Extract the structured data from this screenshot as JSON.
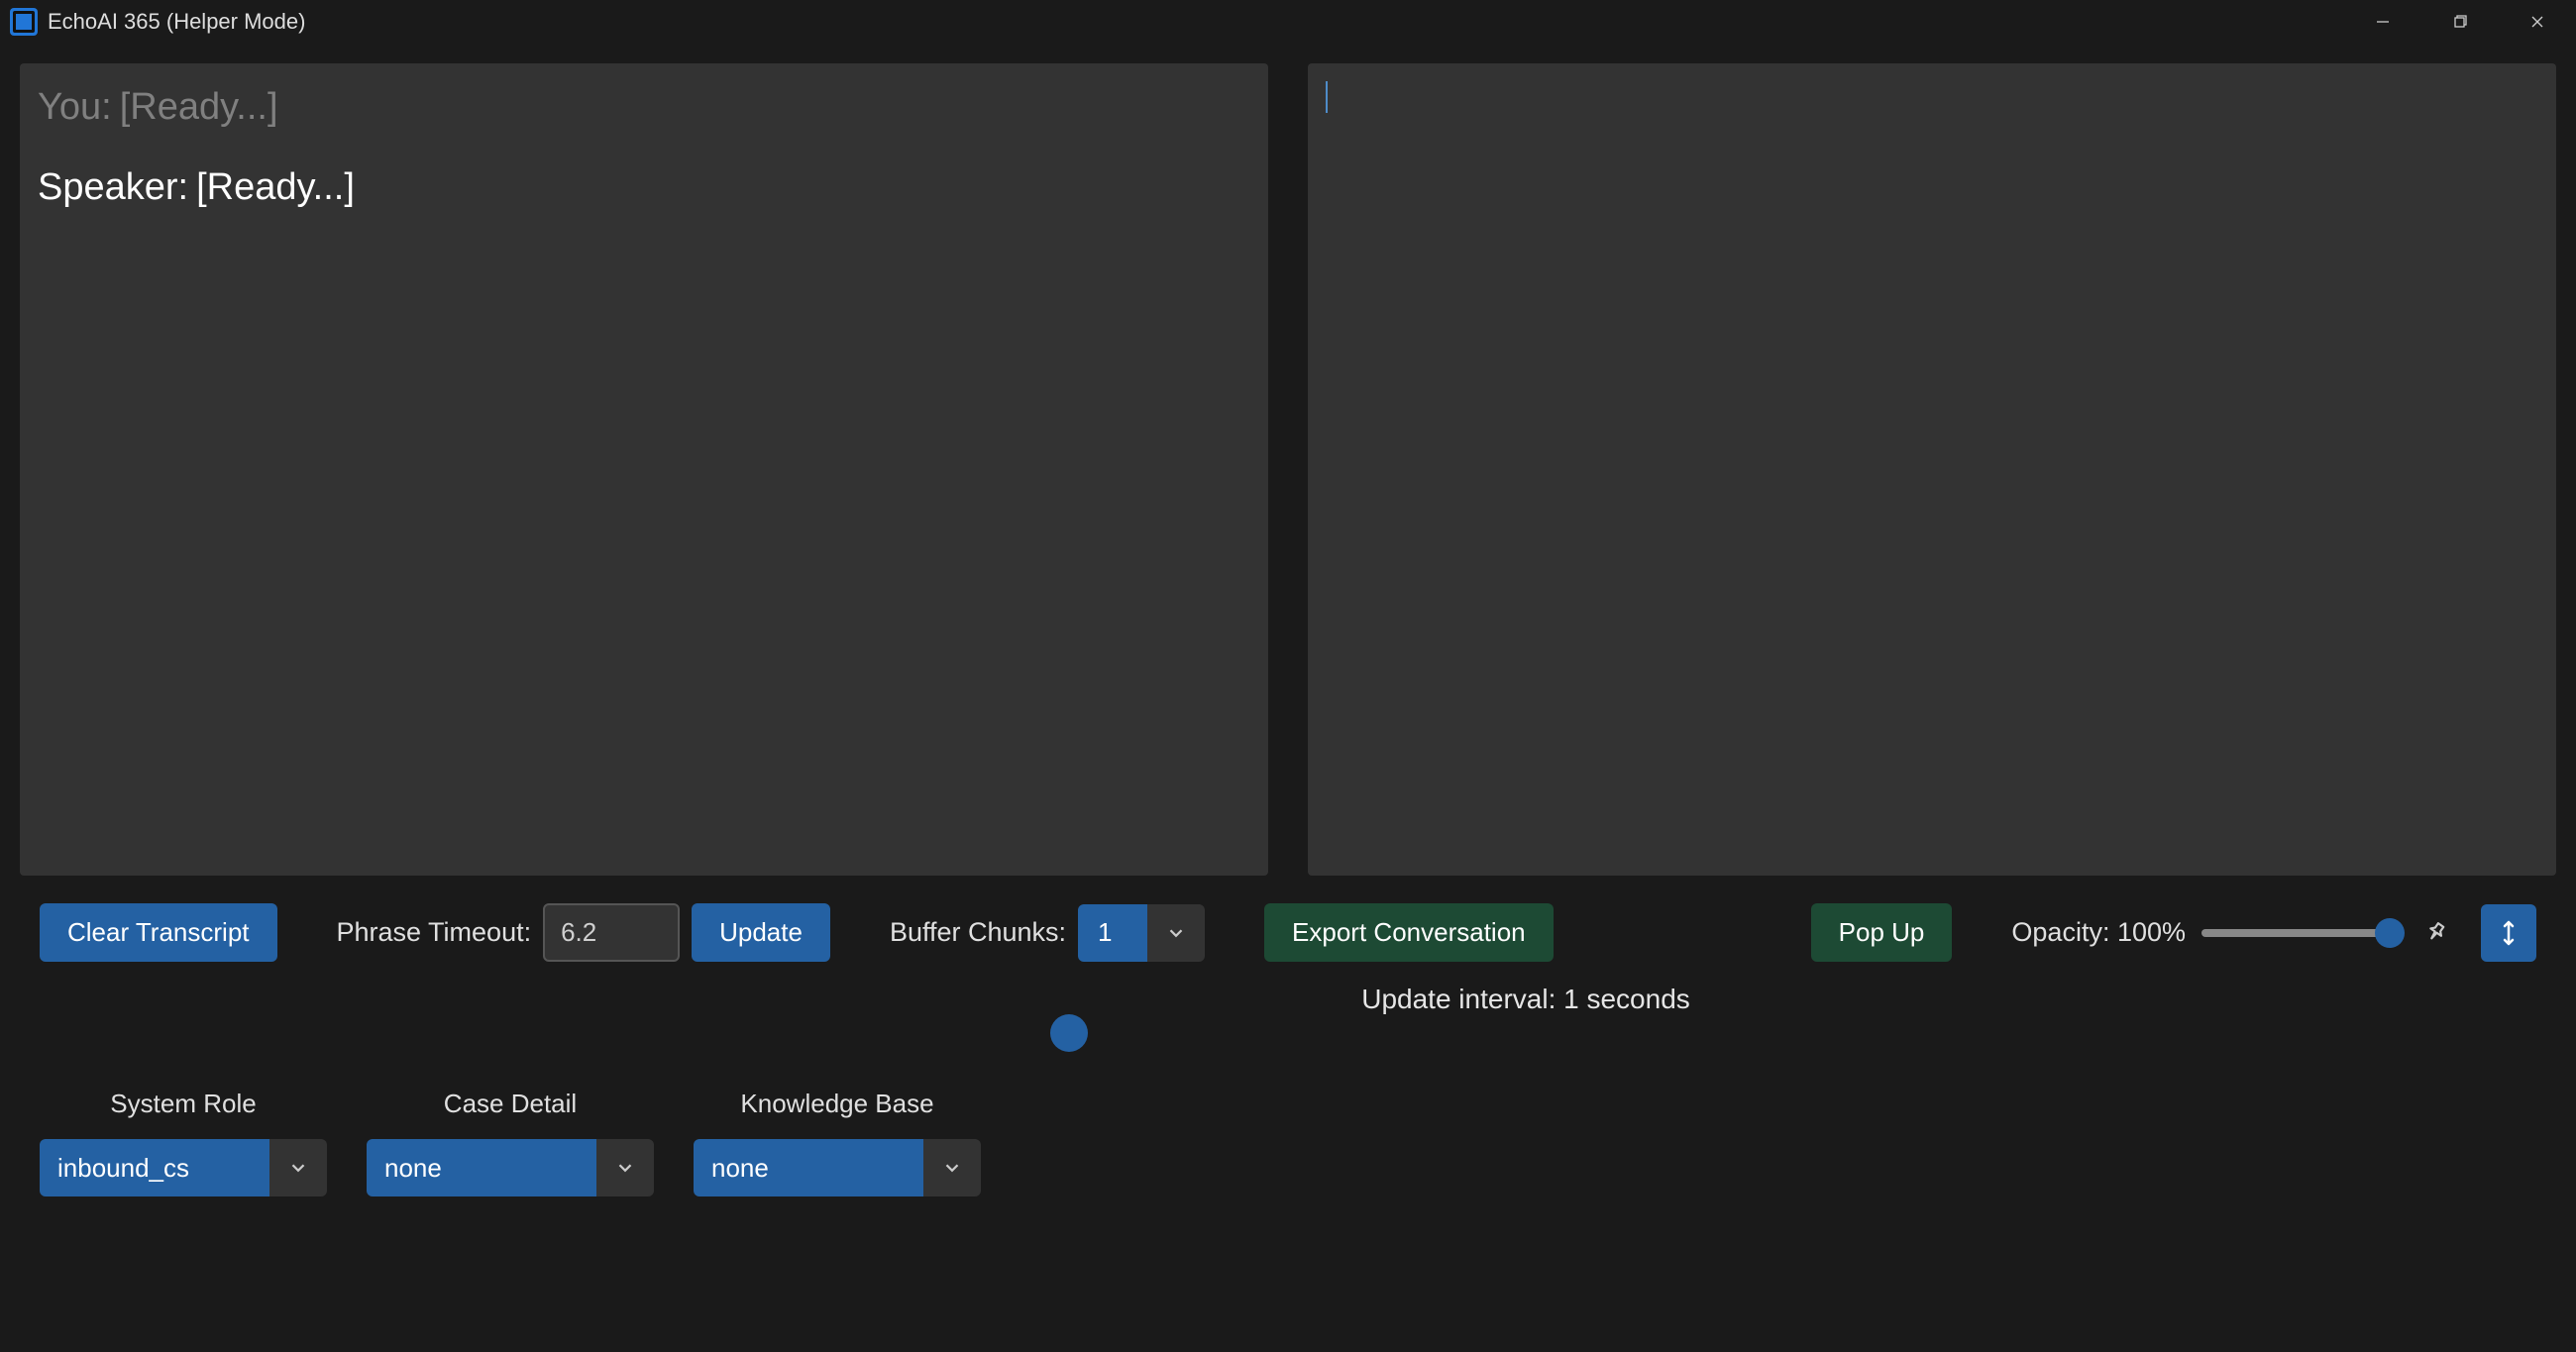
{
  "window": {
    "title": "EchoAI 365 (Helper Mode)"
  },
  "transcript": {
    "you_prefix": "You:",
    "you_status": "[Ready...]",
    "speaker_prefix": "Speaker:",
    "speaker_status": "[Ready...]"
  },
  "controls": {
    "clear_transcript": "Clear Transcript",
    "phrase_timeout_label": "Phrase Timeout:",
    "phrase_timeout_value": "6.2",
    "update": "Update",
    "buffer_chunks_label": "Buffer Chunks:",
    "buffer_chunks_value": "1",
    "export": "Export Conversation",
    "pop_up": "Pop Up",
    "opacity_label": "Opacity: 100%",
    "opacity_percent": 100
  },
  "interval": {
    "label": "Update interval: 1 seconds",
    "value": 1
  },
  "selectors": {
    "system_role": {
      "label": "System Role",
      "value": "inbound_cs"
    },
    "case_detail": {
      "label": "Case Detail",
      "value": "none"
    },
    "knowledge_base": {
      "label": "Knowledge Base",
      "value": "none"
    }
  }
}
